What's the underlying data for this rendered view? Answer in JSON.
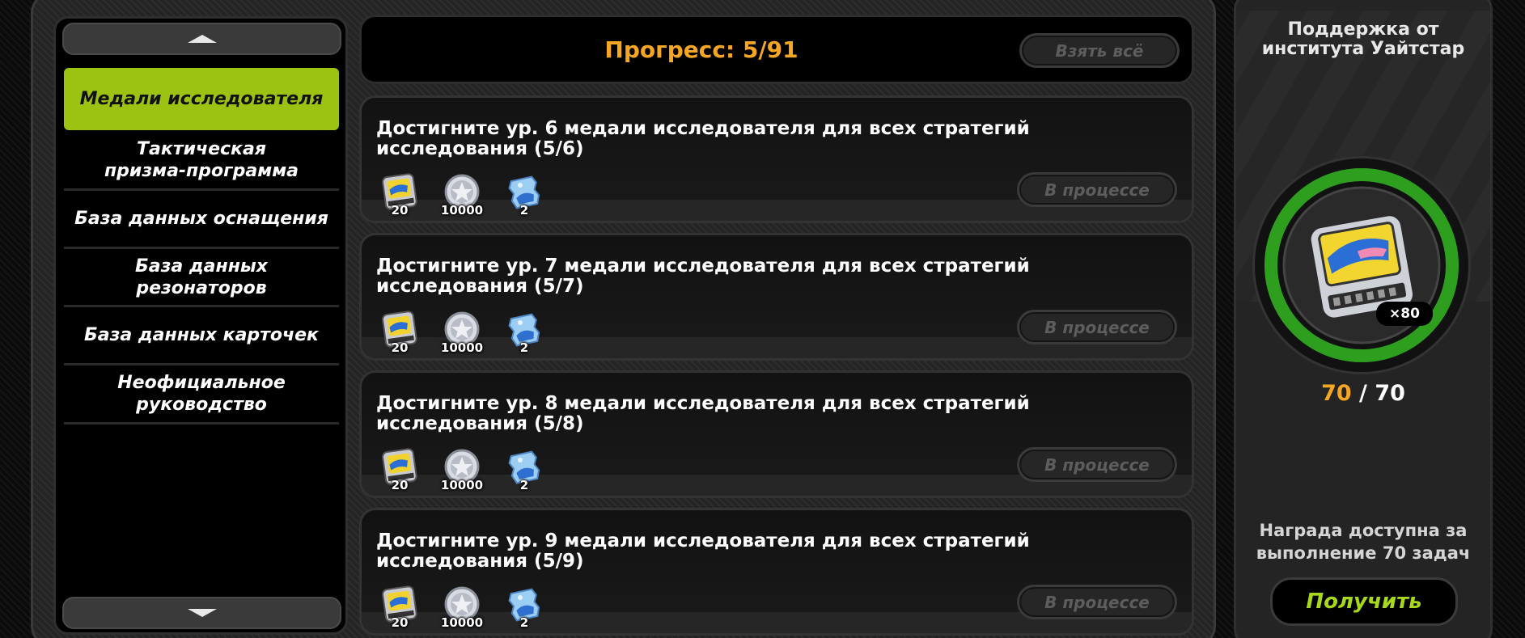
{
  "nav": {
    "items": [
      {
        "label": "Медали исследователя",
        "active": true
      },
      {
        "label": "Тактическая\nпризма-программа",
        "active": false
      },
      {
        "label": "База данных оснащения",
        "active": false
      },
      {
        "label": "База данных\nрезонаторов",
        "active": false
      },
      {
        "label": "База данных карточек",
        "active": false
      },
      {
        "label": "Неофициальное\nруководство",
        "active": false
      }
    ]
  },
  "header": {
    "progress": "Прогресс: 5/91",
    "take_all_label": "Взять всё"
  },
  "tasks": [
    {
      "title": "Достигните ур. 6 медали исследователя для всех стратегий исследования (5/6)",
      "rewards": [
        "20",
        "10000",
        "2"
      ],
      "status": "В процессе"
    },
    {
      "title": "Достигните ур. 7 медали исследователя для всех стратегий исследования (5/7)",
      "rewards": [
        "20",
        "10000",
        "2"
      ],
      "status": "В процессе"
    },
    {
      "title": "Достигните ур. 8 медали исследователя для всех стратегий исследования (5/8)",
      "rewards": [
        "20",
        "10000",
        "2"
      ],
      "status": "В процессе"
    },
    {
      "title": "Достигните ур. 9 медали исследователя для всех стратегий исследования (5/9)",
      "rewards": [
        "20",
        "10000",
        "2"
      ],
      "status": "В процессе"
    }
  ],
  "reward_icons": [
    "film-ticket-icon",
    "silver-coin-icon",
    "blue-ticket-icon"
  ],
  "side": {
    "title": "Поддержка от\nинститута Уайтстар",
    "reward_multiplier": "×80",
    "current": "70",
    "separator": " / ",
    "total": "70",
    "progress_fraction": 1.0,
    "note": "Награда доступна за\nвыполнение 70 задач",
    "claim_label": "Получить"
  },
  "colors": {
    "accent_green": "#9cc312",
    "progress_orange": "#f5a623",
    "ring_green": "#2e9e1f",
    "claim_text": "#a8d81b"
  }
}
